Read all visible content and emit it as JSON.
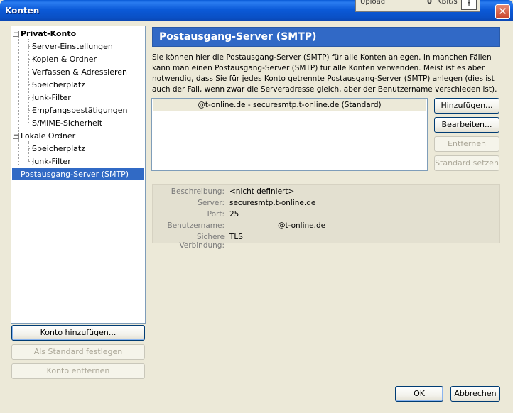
{
  "window": {
    "title": "Konten",
    "close_glyph": "✕"
  },
  "overlay": {
    "label": "Upload",
    "value": "0",
    "unit": "KBit/s",
    "tool_glyph": "ⱡ"
  },
  "tree": {
    "group1": {
      "label": "Privat-Konto",
      "children": [
        "Server-Einstellungen",
        "Kopien & Ordner",
        "Verfassen & Adressieren",
        "Speicherplatz",
        "Junk-Filter",
        "Empfangsbestätigungen",
        "S/MIME-Sicherheit"
      ]
    },
    "group2": {
      "label": "Lokale Ordner",
      "children": [
        "Speicherplatz",
        "Junk-Filter"
      ]
    },
    "selected": "Postausgang-Server (SMTP)",
    "expander_glyph": "−"
  },
  "left_buttons": {
    "add_account": "Konto hinzufügen...",
    "set_default": "Als Standard festlegen",
    "remove_account": "Konto entfernen"
  },
  "panel": {
    "title": "Postausgang-Server (SMTP)",
    "description": "Sie können hier die Postausgang-Server (SMTP) für alle Konten anlegen. In manchen Fällen kann man einen Postausgang-Server (SMTP) für alle Konten verwenden. Meist ist es aber notwendig, dass Sie für jedes Konto getrennte Postausgang-Server (SMTP) anlegen (dies ist auch der Fall, wenn zwar die Serveradresse gleich, aber der Benutzername verschieden ist).",
    "server_entry": "@t-online.de - securesmtp.t-online.de (Standard)",
    "buttons": {
      "add": "Hinzufügen...",
      "edit": "Bearbeiten...",
      "remove": "Entfernen",
      "set_default": "Standard setzen"
    },
    "details": {
      "desc_label": "Beschreibung:",
      "desc_value": "<nicht definiert>",
      "server_label": "Server:",
      "server_value": "securesmtp.t-online.de",
      "port_label": "Port:",
      "port_value": "25",
      "user_label": "Benutzername:",
      "user_value": "@t-online.de",
      "secure_label": "Sichere Verbindung:",
      "secure_value": "TLS"
    }
  },
  "dialog_buttons": {
    "ok": "OK",
    "cancel": "Abbrechen"
  }
}
